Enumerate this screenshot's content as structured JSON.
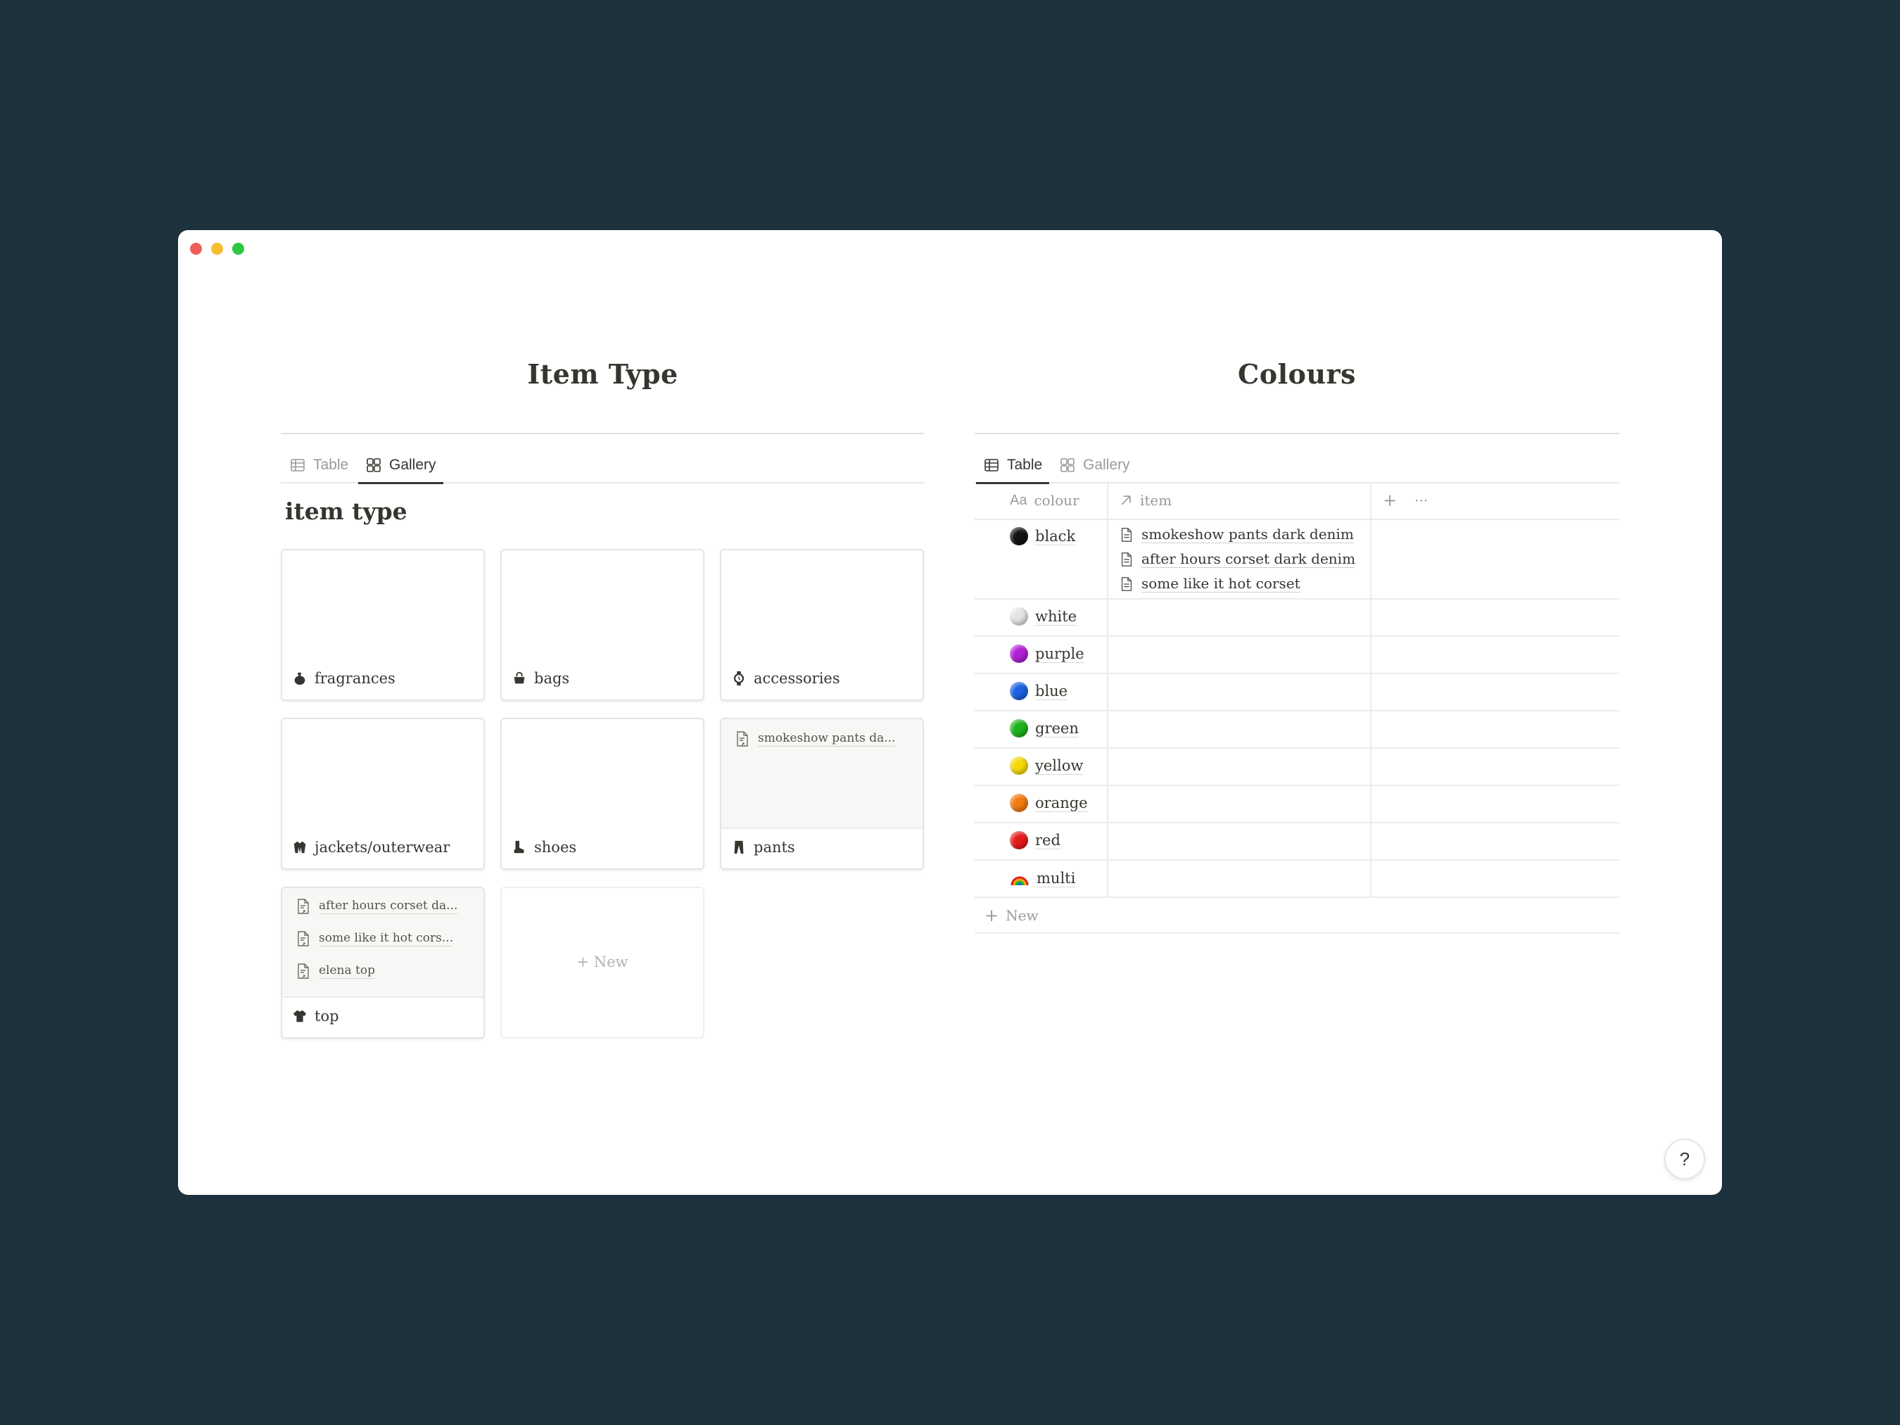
{
  "left": {
    "heading": "Item Type",
    "tabs": [
      {
        "label": "Table",
        "icon": "table-icon",
        "active": false
      },
      {
        "label": "Gallery",
        "icon": "gallery-icon",
        "active": true
      }
    ],
    "section_title": "item type",
    "cards": [
      {
        "label": "fragrances",
        "icon": "perfume-icon",
        "items": []
      },
      {
        "label": "bags",
        "icon": "handbag-icon",
        "items": []
      },
      {
        "label": "accessories",
        "icon": "watch-icon",
        "items": []
      },
      {
        "label": "jackets/outerwear",
        "icon": "coat-icon",
        "items": []
      },
      {
        "label": "shoes",
        "icon": "boot-icon",
        "items": []
      },
      {
        "label": "pants",
        "icon": "pants-icon",
        "items": [
          "smokeshow pants da..."
        ]
      },
      {
        "label": "top",
        "icon": "shirt-icon",
        "items": [
          "after hours corset da...",
          "some like it hot cors...",
          "elena top"
        ]
      }
    ],
    "new_label": "New"
  },
  "right": {
    "heading": "Colours",
    "tabs": [
      {
        "label": "Table",
        "icon": "table-icon",
        "active": true
      },
      {
        "label": "Gallery",
        "icon": "gallery-icon",
        "active": false
      }
    ],
    "columns": {
      "colour": "colour",
      "colour_prefix": "Aa",
      "item": "item",
      "add": "+",
      "more": "···"
    },
    "rows": [
      {
        "name": "black",
        "color": "#111111",
        "items": [
          "smokeshow pants dark denim",
          "after hours corset dark denim",
          "some like it hot corset"
        ]
      },
      {
        "name": "white",
        "color": "#e4e4e4",
        "items": []
      },
      {
        "name": "purple",
        "color": "#b01fd6",
        "items": []
      },
      {
        "name": "blue",
        "color": "#1a62e0",
        "items": []
      },
      {
        "name": "green",
        "color": "#1db31d",
        "items": []
      },
      {
        "name": "yellow",
        "color": "#f5d90a",
        "items": []
      },
      {
        "name": "orange",
        "color": "#f27a10",
        "items": []
      },
      {
        "name": "red",
        "color": "#e41b1b",
        "items": []
      },
      {
        "name": "multi",
        "color": "rainbow",
        "items": []
      }
    ],
    "new_label": "New"
  },
  "help_label": "?"
}
